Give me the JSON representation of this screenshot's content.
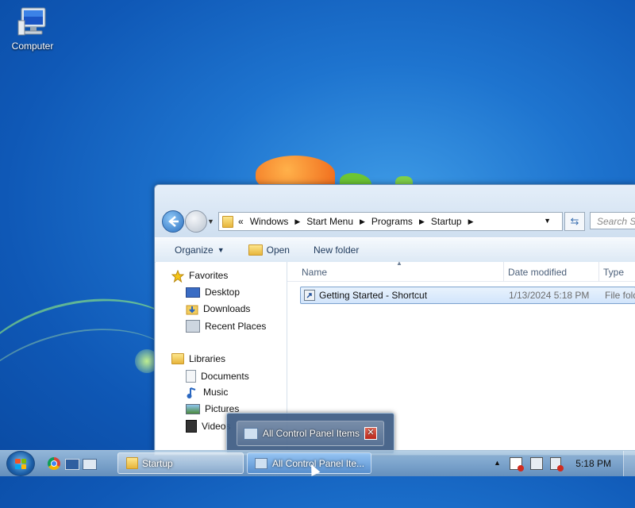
{
  "desktop": {
    "icons": [
      {
        "label": "Computer",
        "icon": "computer-icon"
      }
    ]
  },
  "explorer": {
    "address": {
      "overflow": "«",
      "crumbs": [
        "Windows",
        "Start Menu",
        "Programs",
        "Startup"
      ]
    },
    "search_placeholder": "Search St",
    "toolbar": {
      "organize": "Organize",
      "open": "Open",
      "new_folder": "New folder"
    },
    "nav": {
      "favorites": "Favorites",
      "favorites_items": [
        "Desktop",
        "Downloads",
        "Recent Places"
      ],
      "libraries": "Libraries",
      "libraries_items": [
        "Documents",
        "Music",
        "Pictures",
        "Videos"
      ]
    },
    "columns": {
      "name": "Name",
      "date_modified": "Date modified",
      "type": "Type"
    },
    "files": [
      {
        "name": "Getting Started - Shortcut",
        "date_modified": "1/13/2024 5:18 PM",
        "type": "File folde"
      }
    ]
  },
  "taskbar": {
    "tasks": [
      {
        "label": "Startup"
      },
      {
        "label": "All Control Panel Ite..."
      }
    ],
    "clock": "5:18 PM",
    "thumbnail_title": "All Control Panel Items"
  },
  "colors": {
    "desktop_blue": "#1e74cf",
    "selection": "#d2e5fb",
    "close_red": "#c83a2a"
  }
}
